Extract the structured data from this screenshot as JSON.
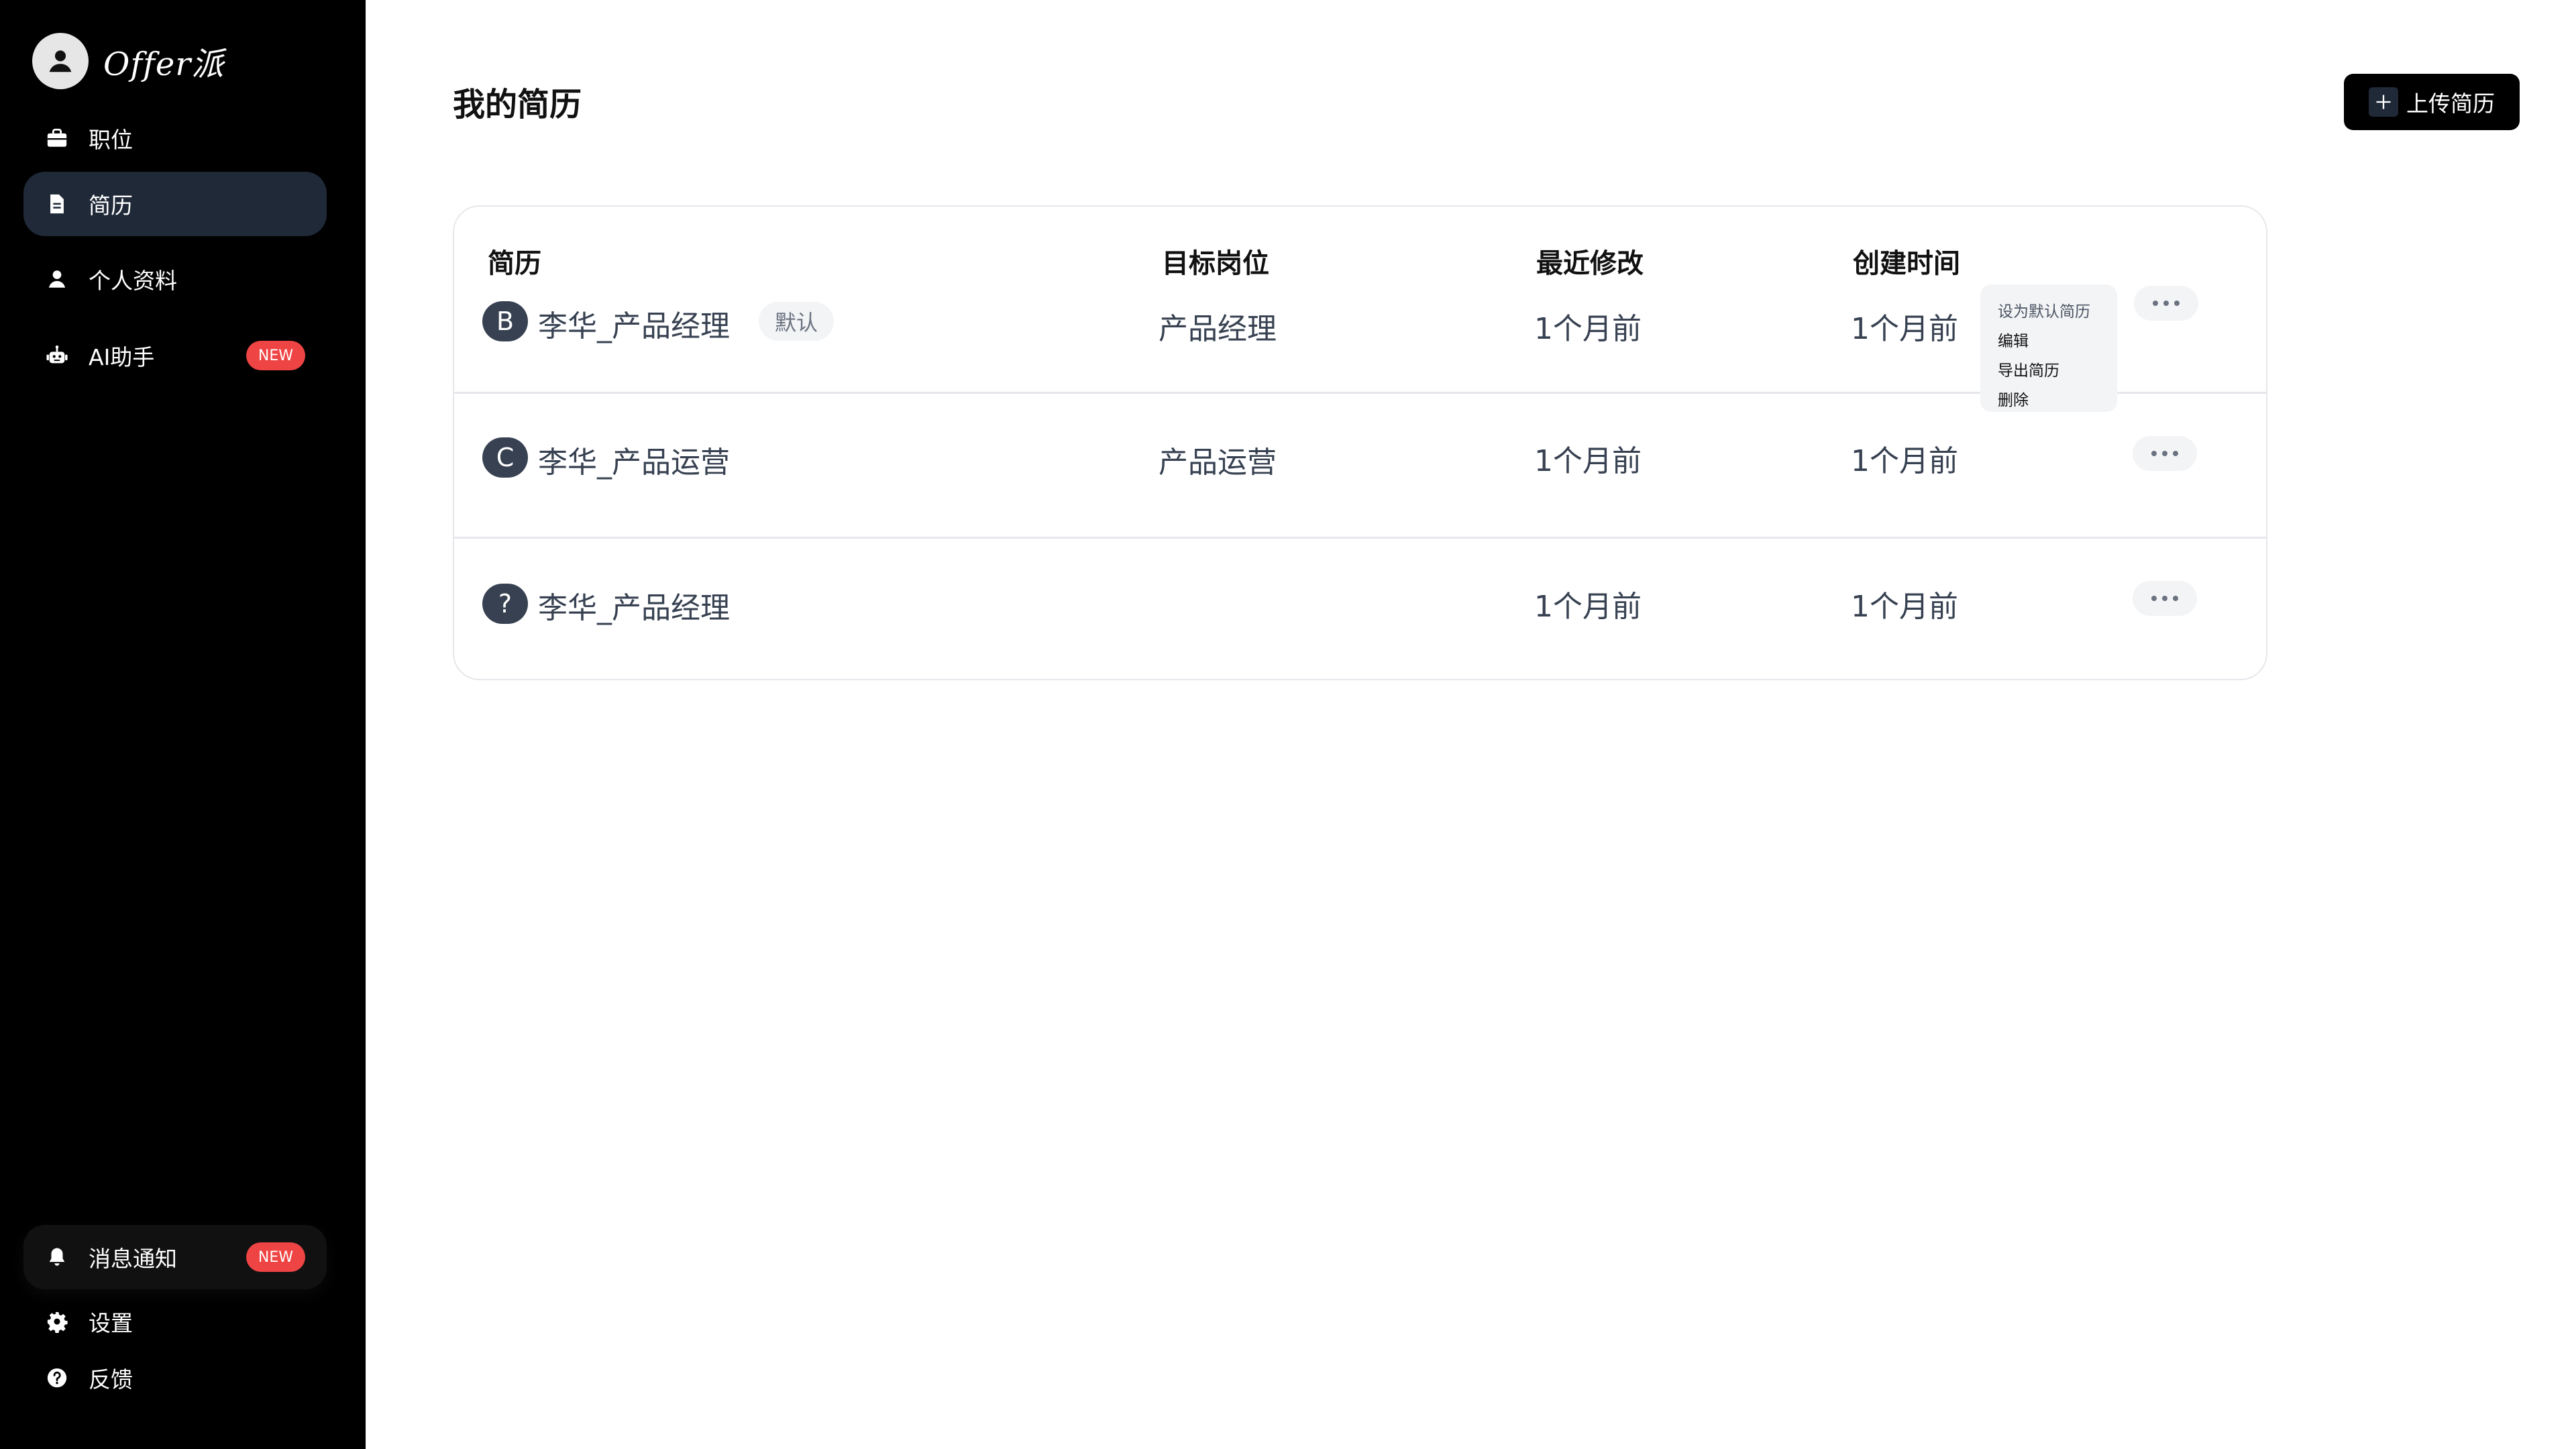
{
  "brand": {
    "name": "Offer派"
  },
  "sidebar": {
    "items": [
      {
        "label": "职位",
        "icon": "briefcase-icon"
      },
      {
        "label": "简历",
        "icon": "document-icon",
        "active": true
      },
      {
        "label": "个人资料",
        "icon": "user-icon"
      },
      {
        "label": "AI助手",
        "icon": "robot-icon",
        "badge": "NEW"
      }
    ],
    "bottom": [
      {
        "label": "消息通知",
        "icon": "bell-icon",
        "badge": "NEW"
      },
      {
        "label": "设置",
        "icon": "gear-icon"
      },
      {
        "label": "反馈",
        "icon": "help-icon"
      }
    ]
  },
  "main": {
    "title": "我的简历",
    "upload_label": "上传简历",
    "table": {
      "headers": [
        "简历",
        "目标岗位",
        "最近修改",
        "创建时间"
      ],
      "rows": [
        {
          "letter": "B",
          "name": "李华_产品经理",
          "tag": "默认",
          "target": "产品经理",
          "modified": "1个月前",
          "created": "1个月前"
        },
        {
          "letter": "C",
          "name": "李华_产品运营",
          "tag": "",
          "target": "产品运营",
          "modified": "1个月前",
          "created": "1个月前"
        },
        {
          "letter": "?",
          "name": "李华_产品经理",
          "tag": "",
          "target": "",
          "modified": "1个月前",
          "created": "1个月前"
        }
      ]
    },
    "dropdown": [
      "设为默认简历",
      "编辑",
      "导出简历",
      "删除"
    ]
  },
  "colors": {
    "sidebar_bg": "#000000",
    "active_bg": "#1f2937",
    "badge": "#ef4444",
    "accent": "#000000"
  }
}
